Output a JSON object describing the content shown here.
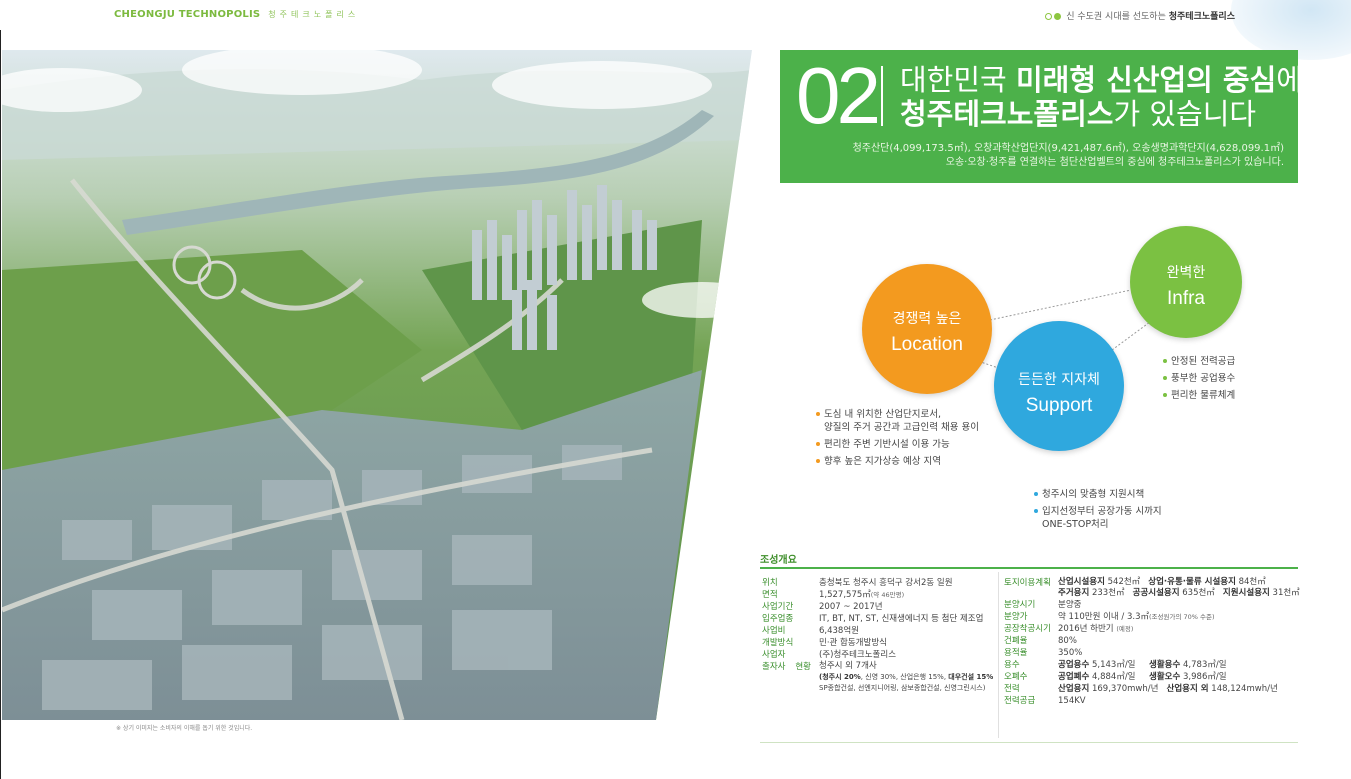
{
  "header": {
    "brand_en": "CHEONGJU TECHNOPOLIS",
    "brand_kr": "청주테크노폴리스",
    "slogan_prefix": "신 수도권 시대를 선도하는",
    "slogan_brand": "청주테크노폴리스"
  },
  "photo": {
    "caption": "※ 상기 이미지는 소비자의 이해를 돕기 위한 것입니다."
  },
  "title": {
    "number": "02",
    "line1_a": "대한민국 ",
    "line1_b": "미래형 신산업의 중심",
    "line1_c": "에",
    "line2_a": "청주테크노폴리스",
    "line2_b": "가 있습니다",
    "sub1": "청주산단(4,099,173.5㎡), 오창과학산업단지(9,421,487.6㎡), 오송생명과학단지(4,628,099.1㎡)",
    "sub2": "오송·오창·청주를 연결하는 첨단산업벨트의 중심에 청주테크노폴리스가 있습니다."
  },
  "diagram": {
    "location": {
      "kr": "경쟁력 높은",
      "en": "Location",
      "bullets": [
        "도심 내 위치한 산업단지로서,\n양질의 주거 공간과 고급인력 채용 용이",
        "편리한 주변 기반시설 이용 가능",
        "향후 높은 지가상승 예상 지역"
      ]
    },
    "infra": {
      "kr": "완벽한",
      "en": "Infra",
      "bullets": [
        "안정된 전력공급",
        "풍부한 공업용수",
        "편리한 물류체계"
      ]
    },
    "support": {
      "kr": "든든한 지자체",
      "en": "Support",
      "bullets": [
        "청주시의 맞춤형 지원시책",
        "입지선정부터 공장가동 시까지\nONE-STOP처리"
      ]
    },
    "colors": {
      "location": "#f39a1f",
      "infra": "#7bc142",
      "support": "#2fa8de"
    }
  },
  "overview": {
    "heading": "조성개요",
    "left": [
      {
        "label": "위치",
        "value": "충청북도 청주시 흥덕구 강서2동 일원"
      },
      {
        "label": "면적",
        "value": "1,527,575㎡",
        "note": "(약 46만평)"
      },
      {
        "label": "사업기간",
        "value": "2007 ~ 2017년"
      },
      {
        "label": "입주업종",
        "value": "IT, BT, NT, ST, 신재생에너지 등 첨단 제조업"
      },
      {
        "label": "사업비",
        "value": "6,438억원"
      },
      {
        "label": "개발방식",
        "value": "민·관 합동개발방식"
      },
      {
        "label": "사업자",
        "value": "(주)청주테크노폴리스"
      },
      {
        "label": "출자사 현황",
        "value": "청주시 외 7개사",
        "detail1_b": "(청주시 20%",
        "detail1": ", 신영 30%, 산업은행 15%, ",
        "detail1_b2": "대우건설 15%",
        "detail2": "SP종합건설, 선엔지니어링, 삼보종합건설, 신영그린시스)"
      }
    ],
    "right": [
      {
        "label": "토지이용계획",
        "line1": [
          [
            "산업시설용지",
            " 542천㎡"
          ],
          [
            "상업·유통·물류 시설용지",
            " 84천㎡"
          ]
        ],
        "line2": [
          [
            "주거용지",
            " 233천㎡"
          ],
          [
            "공공시설용지",
            " 635천㎡"
          ],
          [
            "지원시설용지",
            " 31천㎡"
          ]
        ]
      },
      {
        "label": "분양시기",
        "value": "분양중"
      },
      {
        "label": "분양가",
        "value": "약 110만원 이내 / 3.3㎡",
        "note": "(조성원가의 70% 수준)"
      },
      {
        "label": "공장착공시기",
        "value": "2016년 하반기",
        "note": "(예정)"
      },
      {
        "label": "건폐율",
        "value": "80%"
      },
      {
        "label": "용적율",
        "value": "350%"
      },
      {
        "label": "용수",
        "pairs": [
          [
            "공업용수",
            " 5,143㎥/일"
          ],
          [
            "생활용수",
            " 4,783㎥/일"
          ]
        ]
      },
      {
        "label": "오폐수",
        "pairs": [
          [
            "공업폐수",
            " 4,884㎥/일"
          ],
          [
            "생활오수",
            " 3,986㎥/일"
          ]
        ]
      },
      {
        "label": "전력",
        "pairs": [
          [
            "산업용지",
            " 169,370mwh/년"
          ],
          [
            "산업용지 외",
            " 148,124mwh/년"
          ]
        ]
      },
      {
        "label": "전력공급",
        "value": "154KV"
      }
    ]
  }
}
